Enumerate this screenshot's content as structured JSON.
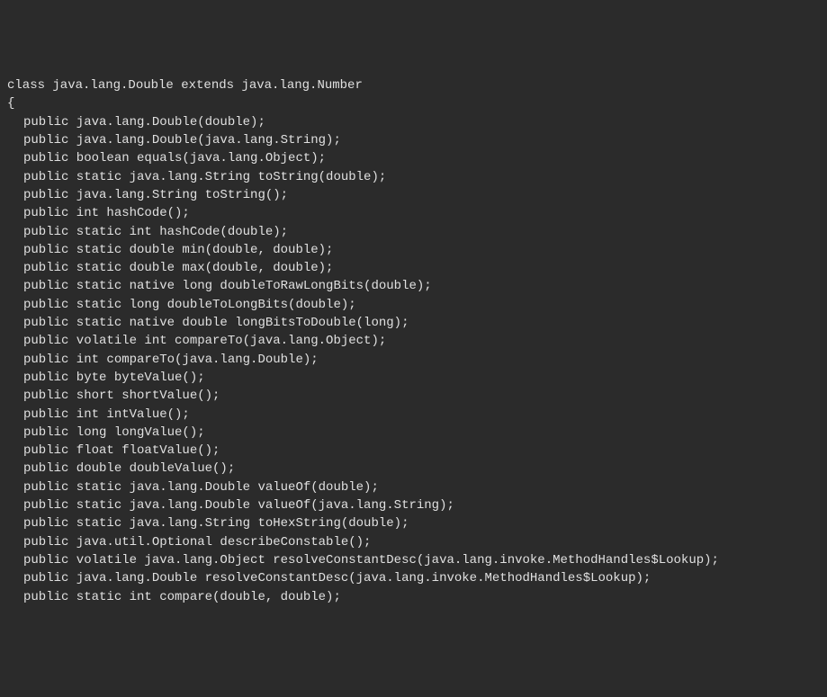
{
  "code": {
    "class_line": "class java.lang.Double extends java.lang.Number",
    "brace_open": "{",
    "lines": [
      "public java.lang.Double(double);",
      "public java.lang.Double(java.lang.String);",
      "",
      "public boolean equals(java.lang.Object);",
      "public static java.lang.String toString(double);",
      "public java.lang.String toString();",
      "public int hashCode();",
      "public static int hashCode(double);",
      "public static double min(double, double);",
      "public static double max(double, double);",
      "public static native long doubleToRawLongBits(double);",
      "public static long doubleToLongBits(double);",
      "public static native double longBitsToDouble(long);",
      "public volatile int compareTo(java.lang.Object);",
      "public int compareTo(java.lang.Double);",
      "public byte byteValue();",
      "public short shortValue();",
      "public int intValue();",
      "public long longValue();",
      "public float floatValue();",
      "public double doubleValue();",
      "public static java.lang.Double valueOf(double);",
      "public static java.lang.Double valueOf(java.lang.String);",
      "public static java.lang.String toHexString(double);",
      "public java.util.Optional describeConstable();",
      "public volatile java.lang.Object resolveConstantDesc(java.lang.invoke.MethodHandles$Lookup);",
      "public java.lang.Double resolveConstantDesc(java.lang.invoke.MethodHandles$Lookup);",
      "public static int compare(double, double);"
    ]
  }
}
